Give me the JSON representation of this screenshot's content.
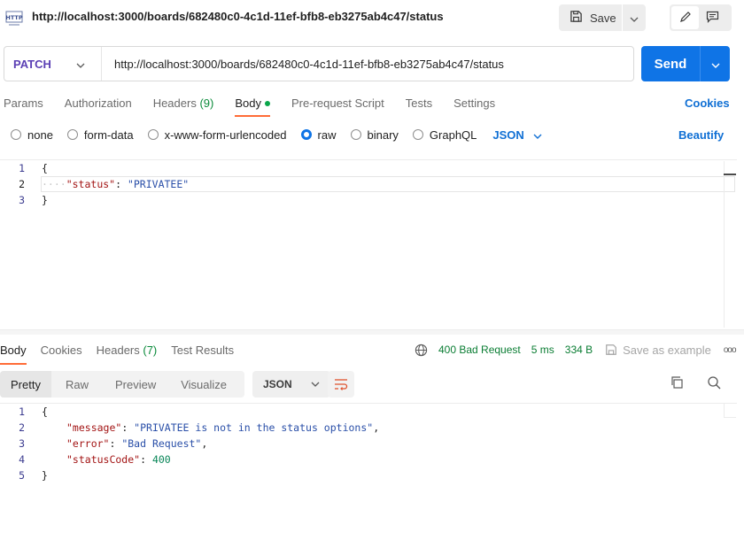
{
  "title_bar": {
    "icon": "http-icon",
    "url": "http://localhost:3000/boards/682480c0-4c1d-11ef-bfb8-eb3275ab4c47/status",
    "save_label": "Save",
    "edit_icon": "pencil-icon",
    "comment_icon": "comment-icon"
  },
  "request": {
    "method": "PATCH",
    "url": "http://localhost:3000/boards/682480c0-4c1d-11ef-bfb8-eb3275ab4c47/status",
    "send_label": "Send",
    "method_color": "#5b3fb4",
    "send_color": "#0f74e6"
  },
  "request_tabs": {
    "params": "Params",
    "authorization": "Authorization",
    "headers": "Headers",
    "headers_count": "(9)",
    "body": "Body",
    "pre_request": "Pre-request Script",
    "tests": "Tests",
    "settings": "Settings",
    "cookies": "Cookies"
  },
  "body_types": {
    "none": "none",
    "form_data": "form-data",
    "urlencoded": "x-www-form-urlencoded",
    "raw": "raw",
    "binary": "binary",
    "graphql": "GraphQL",
    "format": "JSON",
    "beautify": "Beautify",
    "selected": "raw"
  },
  "request_body": {
    "line_numbers": [
      "1",
      "2",
      "3"
    ],
    "open": "{",
    "key": "\"status\"",
    "colon": ": ",
    "value": "\"PRIVATEE\"",
    "close": "}"
  },
  "response_tabs": {
    "body": "Body",
    "cookies": "Cookies",
    "headers": "Headers",
    "headers_count": "(7)",
    "test_results": "Test Results"
  },
  "response_status": {
    "status": "400 Bad Request",
    "time": "5 ms",
    "size": "334 B",
    "save_example": "Save as example",
    "more": "ooo"
  },
  "response_view": {
    "pretty": "Pretty",
    "raw": "Raw",
    "preview": "Preview",
    "visualize": "Visualize",
    "format": "JSON"
  },
  "response_body": {
    "line_numbers": [
      "1",
      "2",
      "3",
      "4",
      "5"
    ],
    "open": "{",
    "message_key": "\"message\"",
    "message_value": "\"PRIVATEE is not in the status options\"",
    "error_key": "\"error\"",
    "error_value": "\"Bad Request\"",
    "status_key": "\"statusCode\"",
    "status_value": "400",
    "close": "}"
  }
}
